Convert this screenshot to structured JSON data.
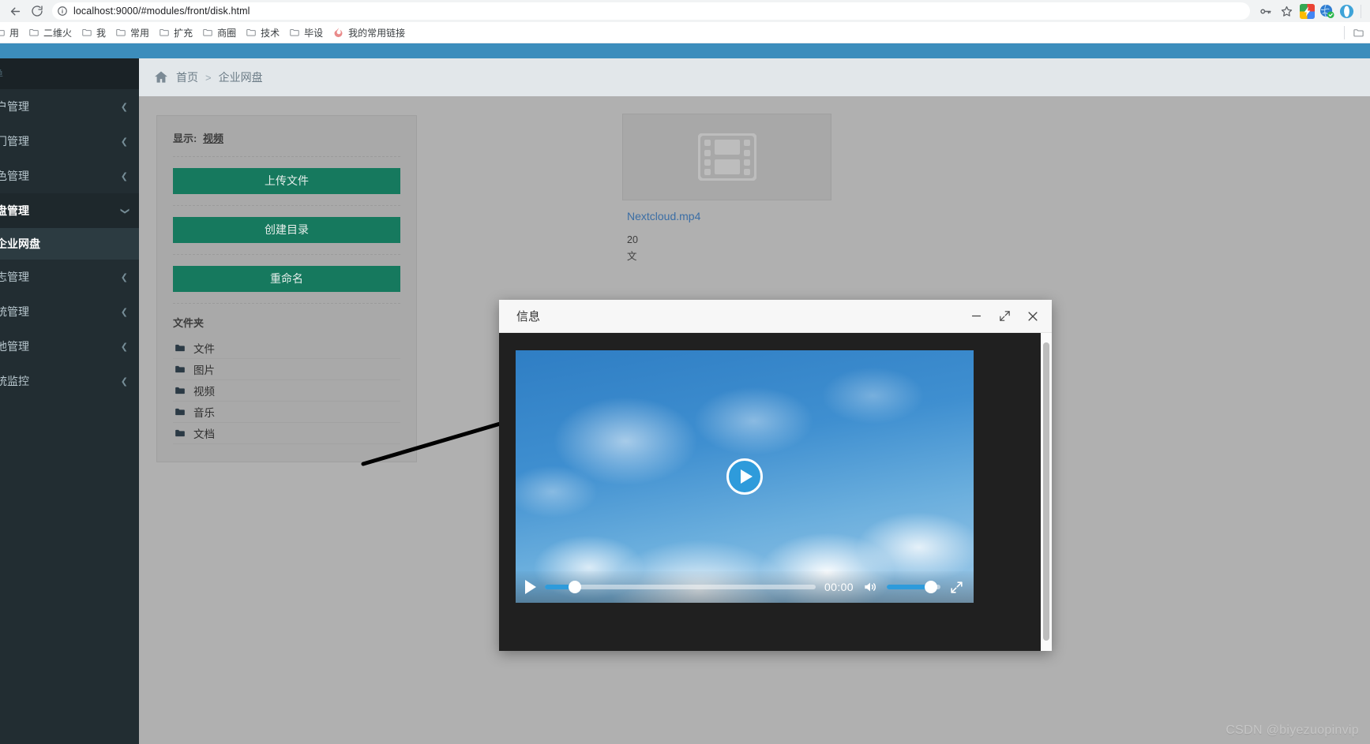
{
  "browser": {
    "back_icon": "back-arrow-icon",
    "reload_icon": "reload-icon",
    "info_icon": "site-info-icon",
    "url": "localhost:9000/#modules/front/disk.html",
    "key_icon": "password-key-icon",
    "star_icon": "bookmark-star-icon",
    "extensions": [
      "extension-colorful-icon",
      "globe-icon",
      "opera-icon"
    ],
    "bookmarks": [
      {
        "label": "用",
        "icon": "folder-icon"
      },
      {
        "label": "二维火",
        "icon": "folder-icon"
      },
      {
        "label": "我",
        "icon": "folder-icon"
      },
      {
        "label": "常用",
        "icon": "folder-icon"
      },
      {
        "label": "扩充",
        "icon": "folder-icon"
      },
      {
        "label": "商圈",
        "icon": "folder-icon"
      },
      {
        "label": "技术",
        "icon": "folder-icon"
      },
      {
        "label": "毕设",
        "icon": "folder-icon"
      },
      {
        "label": "我的常用链接",
        "icon": "flame-icon"
      }
    ]
  },
  "sidebar": {
    "section_label": "单",
    "items": [
      {
        "label": "户管理",
        "chevron": "chevron-left-icon",
        "state": "collapsed"
      },
      {
        "label": "门管理",
        "chevron": "chevron-left-icon",
        "state": "collapsed"
      },
      {
        "label": "色管理",
        "chevron": "chevron-left-icon",
        "state": "collapsed"
      },
      {
        "label": "盘管理",
        "chevron": "chevron-down-icon",
        "state": "open"
      },
      {
        "label": "志管理",
        "chevron": "chevron-left-icon",
        "state": "collapsed"
      },
      {
        "label": "统管理",
        "chevron": "chevron-left-icon",
        "state": "collapsed"
      },
      {
        "label": "他管理",
        "chevron": "chevron-left-icon",
        "state": "collapsed"
      },
      {
        "label": "统监控",
        "chevron": "chevron-left-icon",
        "state": "collapsed"
      }
    ],
    "active_sub_item": "企业网盘"
  },
  "breadcrumb": {
    "home_icon": "home-icon",
    "home": "首页",
    "separator": ">",
    "current": "企业网盘"
  },
  "panel": {
    "show_label": "显示:",
    "show_value": "视频",
    "buttons": [
      {
        "label": "上传文件",
        "name": "upload-file-button"
      },
      {
        "label": "创建目录",
        "name": "create-directory-button"
      },
      {
        "label": "重命名",
        "name": "rename-button"
      }
    ],
    "folders_title": "文件夹",
    "folders": [
      {
        "label": "文件",
        "icon": "folder-icon"
      },
      {
        "label": "图片",
        "icon": "folder-icon"
      },
      {
        "label": "视频",
        "icon": "folder-icon"
      },
      {
        "label": "音乐",
        "icon": "folder-icon"
      },
      {
        "label": "文档",
        "icon": "folder-icon"
      }
    ]
  },
  "file_card": {
    "thumb_icon": "film-strip-icon",
    "name": "Nextcloud.mp4",
    "meta_line1": "20",
    "meta_line2": "文"
  },
  "modal": {
    "title": "信息",
    "minimize_icon": "minimize-icon",
    "maximize_icon": "maximize-icon",
    "close_icon": "close-icon",
    "scrollbar": "vertical-scrollbar",
    "video": {
      "poster": "sky-clouds-poster",
      "overlay_play_icon": "play-circle-icon",
      "play_icon": "play-icon",
      "current_time": "00:00",
      "progress_percent": 11,
      "volume_icon": "volume-high-icon",
      "volume_percent": 82,
      "fullscreen_icon": "fullscreen-icon"
    }
  },
  "watermark": "CSDN @biyezuopinvip",
  "colors": {
    "brand_blue": "#3c8dbc",
    "sidebar_dark": "#222d32",
    "button_green": "#16795e",
    "accent_blue": "#2e9bdb",
    "link_blue": "#3b6ea5"
  }
}
